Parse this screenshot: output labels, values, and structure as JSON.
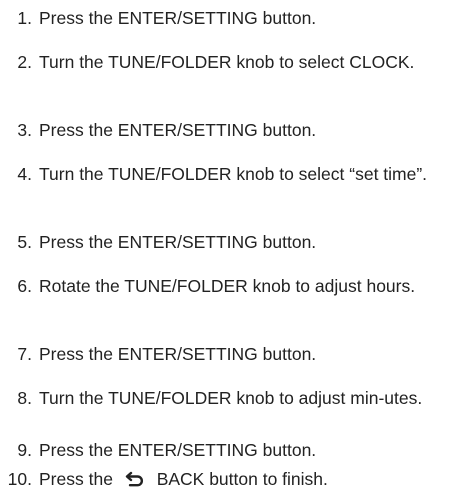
{
  "steps": [
    {
      "num": "1.",
      "text": "Press the ENTER/SETTING button."
    },
    {
      "num": "2.",
      "text": "Turn the TUNE/FOLDER knob to select CLOCK."
    },
    {
      "num": "3.",
      "text": "Press the ENTER/SETTING button."
    },
    {
      "num": "4.",
      "text": "Turn the TUNE/FOLDER knob to select “set time”."
    },
    {
      "num": "5.",
      "text": "Press the ENTER/SETTING button."
    },
    {
      "num": "6.",
      "text": "Rotate the TUNE/FOLDER knob to adjust hours."
    },
    {
      "num": "7.",
      "text": "Press the ENTER/SETTING button."
    },
    {
      "num": "8.",
      "text": "Turn the TUNE/FOLDER knob to adjust min-utes."
    },
    {
      "num": "9.",
      "text": "Press the ENTER/SETTING button."
    },
    {
      "num": "10.",
      "text_before": "Press the",
      "icon": "back-arrow-icon",
      "text_after": "BACK button to finish."
    }
  ]
}
